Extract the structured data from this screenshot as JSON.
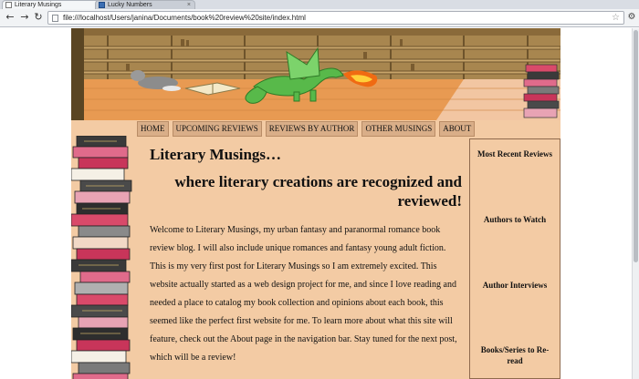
{
  "browser": {
    "tabs": [
      {
        "title": "Literary Musings",
        "active": true
      },
      {
        "title": "Lucky Numbers",
        "active": false
      }
    ],
    "url": "file:///localhost/Users/janina/Documents/book%20review%20site/index.html",
    "icons": [
      "back-arrow-icon",
      "forward-arrow-icon",
      "reload-icon",
      "page-icon",
      "star-icon",
      "wrench-icon"
    ]
  },
  "nav": {
    "items": [
      "HOME",
      "UPCOMING REVIEWS",
      "REVIEWS BY AUTHOR",
      "OTHER MUSINGS",
      "ABOUT"
    ]
  },
  "main": {
    "title": "Literary Musings…",
    "tagline": "where literary creations are recognized and reviewed!",
    "intro": "Welcome to Literary Musings, my urban fantasy and paranormal romance book review blog. I will also include unique romances and fantasy young adult fiction. This is my very first post for Literary Musings so I am extremely excited. This website actually started as a web design project for me, and since I love reading and needed a place to catalog my book collection and opinions about each book, this seemed like the perfect first website for me. To learn more about what this site will feature, check out the About page in the navigation bar. Stay tuned for the next post, which will be a review!"
  },
  "sidebar": {
    "items": [
      "Most Recent Reviews",
      "Authors to Watch",
      "Author Interviews",
      "Books/Series to Re-read"
    ]
  },
  "colors": {
    "page_background": "#f3cba4",
    "nav_button": "#d9ae88",
    "floor": "#e89a52",
    "wall": "#a8864f",
    "dragon": "#58b94a",
    "fire": "#f06a12"
  }
}
